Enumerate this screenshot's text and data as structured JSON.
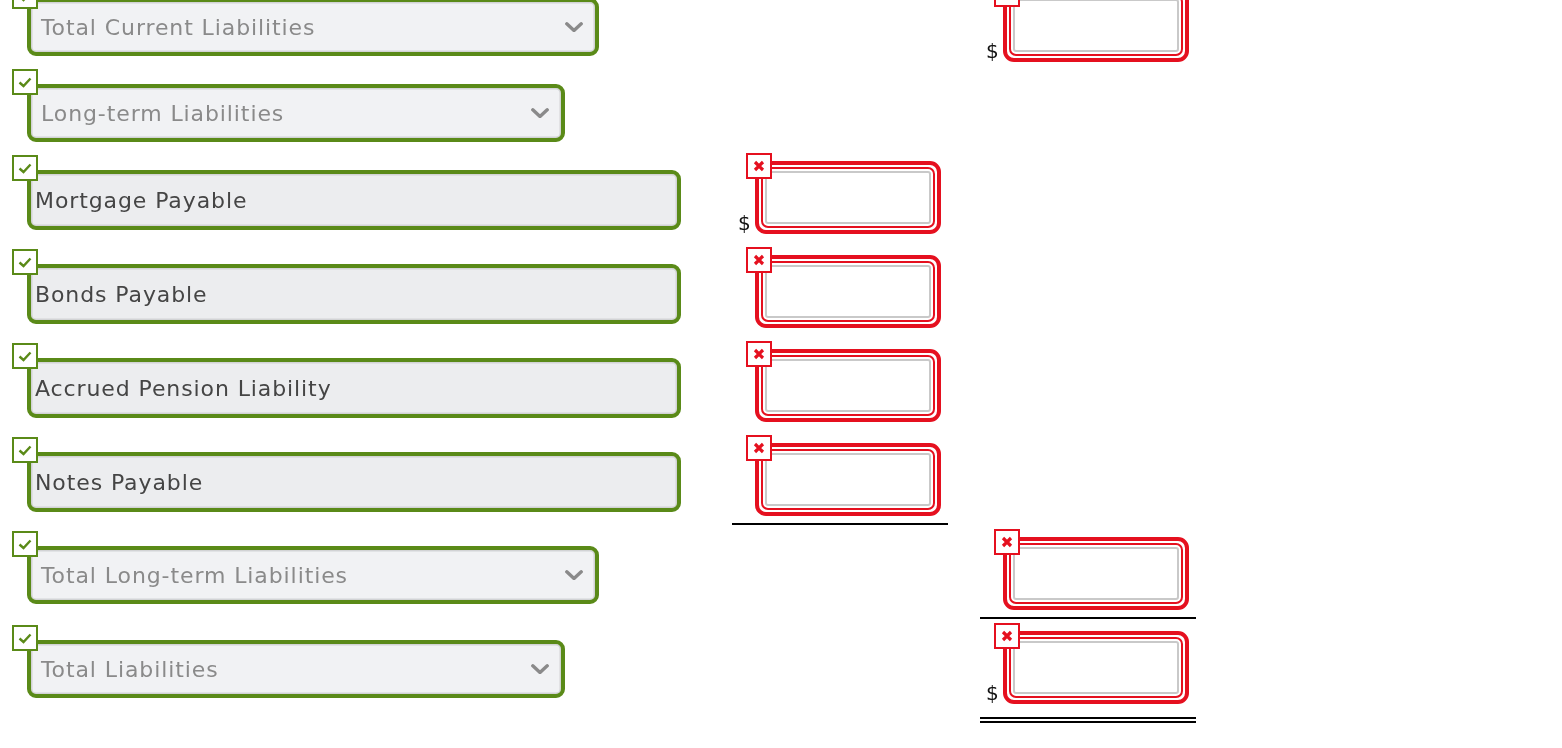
{
  "rows": [
    {
      "kind": "select",
      "label": "Total Current Liabilities",
      "correct": true,
      "total_amount": {
        "currency": "$",
        "correct": false
      }
    },
    {
      "kind": "select",
      "label": "Long-term Liabilities",
      "correct": true
    },
    {
      "kind": "text",
      "label": "Mortgage Payable",
      "correct": true,
      "detail_amount": {
        "currency": "$",
        "correct": false
      }
    },
    {
      "kind": "text",
      "label": "Bonds Payable",
      "correct": true,
      "detail_amount": {
        "correct": false
      }
    },
    {
      "kind": "text",
      "label": "Accrued Pension Liability",
      "correct": true,
      "detail_amount": {
        "correct": false
      }
    },
    {
      "kind": "text",
      "label": "Notes Payable",
      "correct": true,
      "detail_amount": {
        "correct": false,
        "underline": true
      }
    },
    {
      "kind": "select",
      "label": "Total Long-term Liabilities",
      "correct": true,
      "total_amount": {
        "correct": false,
        "underline": true
      }
    },
    {
      "kind": "select",
      "label": "Total Liabilities",
      "correct": true,
      "total_amount": {
        "currency": "$",
        "correct": false,
        "double_underline": true
      }
    }
  ]
}
